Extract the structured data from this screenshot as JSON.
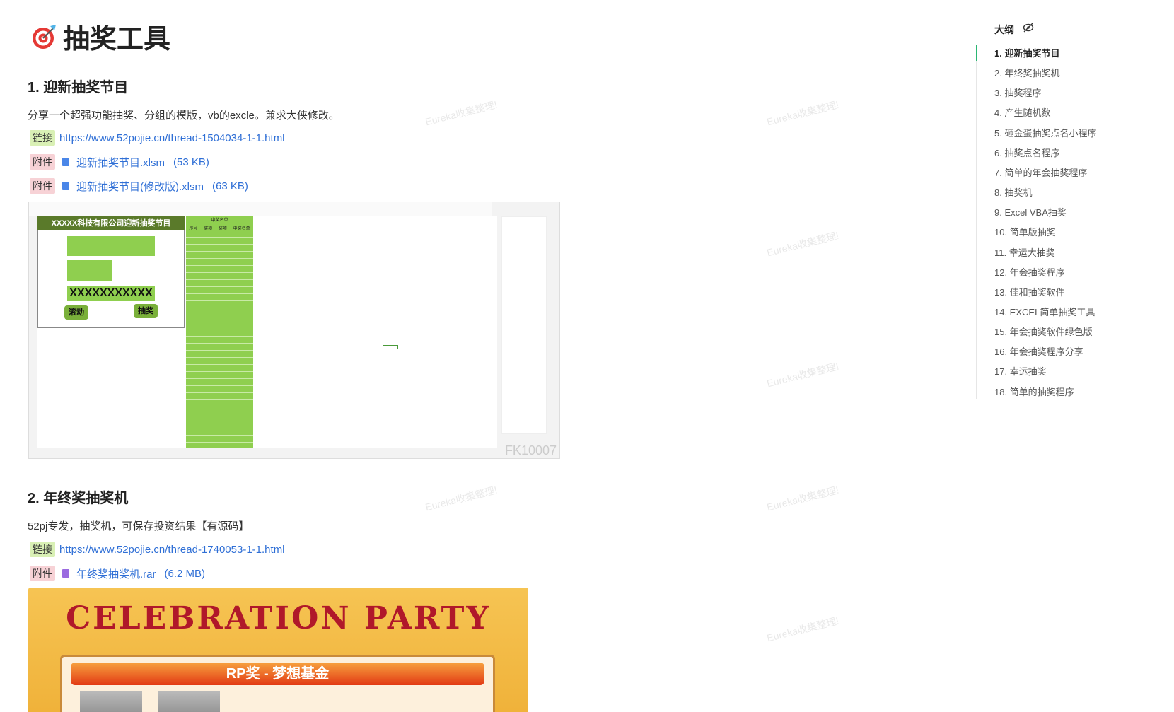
{
  "title": "抽奖工具",
  "watermark": "Eureka收集整理!",
  "sections": [
    {
      "heading": "1. 迎新抽奖节目",
      "desc": "分享一个超强功能抽奖、分组的模版，vb的excle。兼求大侠修改。",
      "link_tag": "链接",
      "link": "https://www.52pojie.cn/thread-1504034-1-1.html",
      "attachments": [
        {
          "tag": "附件",
          "name": "迎新抽奖节目.xlsm",
          "size": "(53 KB)"
        },
        {
          "tag": "附件",
          "name": "迎新抽奖节目(修改版).xlsm",
          "size": "(63 KB)"
        }
      ],
      "image": {
        "banner": "XXXXX科技有限公司迎新抽奖节目",
        "display": "XXXXXXXXXXX",
        "btn_scroll": "滚动",
        "btn_draw": "抽奖",
        "list_title": "中奖名单",
        "cols": [
          "序号",
          "奖项",
          "奖项",
          "中奖名单"
        ],
        "code": "FK10007"
      }
    },
    {
      "heading": "2. 年终奖抽奖机",
      "desc": "52pj专发，抽奖机，可保存投资结果【有源码】",
      "link_tag": "链接",
      "link": "https://www.52pojie.cn/thread-1740053-1-1.html",
      "attachments": [
        {
          "tag": "附件",
          "name": "年终奖抽奖机.rar",
          "size": "(6.2 MB)"
        }
      ],
      "image": {
        "title": "CELEBRATION PARTY",
        "bar": "RP奖 - 梦想基金"
      }
    }
  ],
  "outline": {
    "title": "大纲",
    "items": [
      "1. 迎新抽奖节目",
      "2. 年终奖抽奖机",
      "3. 抽奖程序",
      "4. 产生随机数",
      "5. 砸金蛋抽奖点名小程序",
      "6. 抽奖点名程序",
      "7. 简单的年会抽奖程序",
      "8. 抽奖机",
      "9. Excel VBA抽奖",
      "10. 简单版抽奖",
      "11. 幸运大抽奖",
      "12. 年会抽奖程序",
      "13. 佳和抽奖软件",
      "14. EXCEL简单抽奖工具",
      "15. 年会抽奖软件绿色版",
      "16. 年会抽奖程序分享",
      "17. 幸运抽奖",
      "18. 简单的抽奖程序"
    ]
  }
}
